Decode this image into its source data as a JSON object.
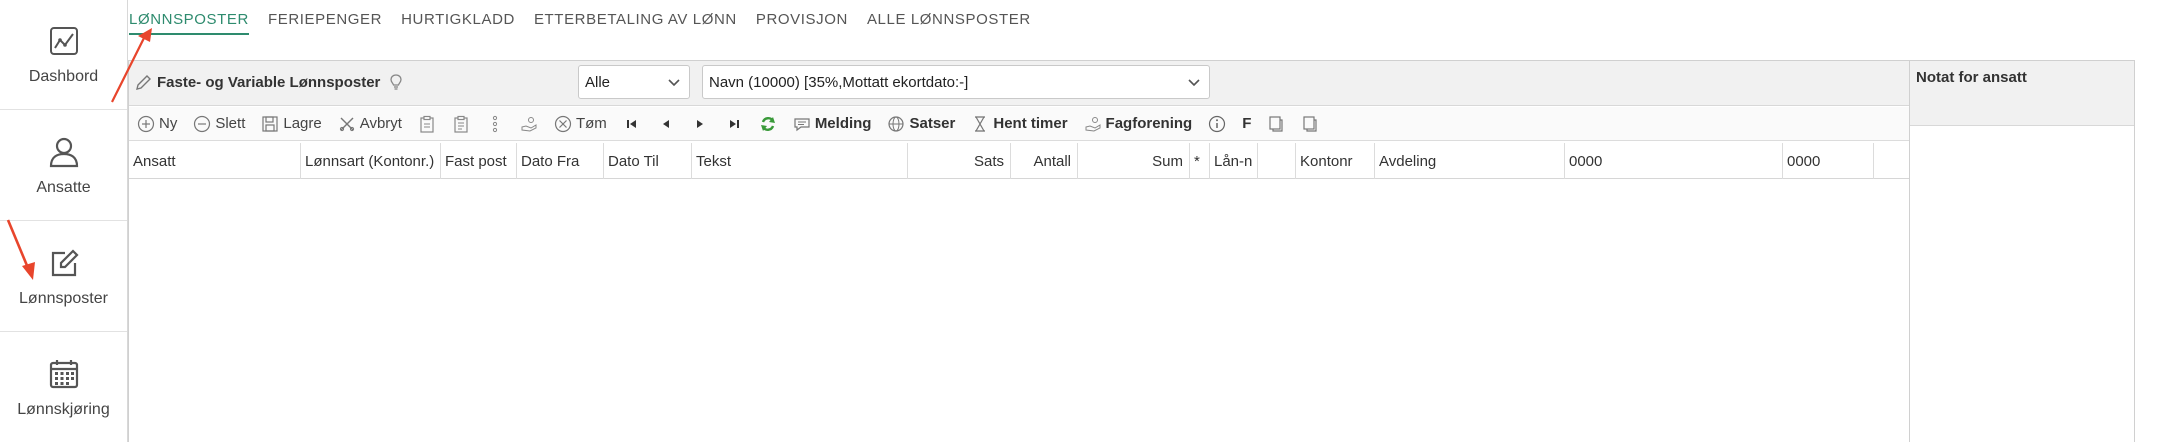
{
  "sidebar": {
    "items": [
      {
        "label": "Dashbord",
        "icon": "chart-icon"
      },
      {
        "label": "Ansatte",
        "icon": "person-icon"
      },
      {
        "label": "Lønnsposter",
        "icon": "edit-icon"
      },
      {
        "label": "Lønnskjøring",
        "icon": "calendar-icon"
      }
    ]
  },
  "tabs": [
    {
      "label": "LØNNSPOSTER",
      "active": true
    },
    {
      "label": "FERIEPENGER"
    },
    {
      "label": "HURTIGKLADD"
    },
    {
      "label": "ETTERBETALING AV LØNN"
    },
    {
      "label": "PROVISJON"
    },
    {
      "label": "ALLE LØNNSPOSTER"
    }
  ],
  "panel": {
    "title": "Faste- og Variable Lønnsposter",
    "filter_value": "Alle",
    "employee_value": "Navn (10000) [35%,Mottatt ekortdato:-]"
  },
  "toolbar": {
    "new": "Ny",
    "delete": "Slett",
    "save": "Lagre",
    "cancel": "Avbryt",
    "clear": "Tøm",
    "message": "Melding",
    "rates": "Satser",
    "get_hours": "Hent timer",
    "union": "Fagforening",
    "f": "F"
  },
  "table": {
    "columns": [
      "Ansatt",
      "Lønnsart (Kontonr.)",
      "Fast post",
      "Dato Fra",
      "Dato Til",
      "Tekst",
      "Sats",
      "Antall",
      "Sum",
      "*",
      "Lån-n",
      "",
      "Kontonr",
      "Avdeling",
      "0000",
      "0000",
      ""
    ]
  },
  "notes": {
    "title": "Notat for ansatt"
  },
  "colors": {
    "accent": "#2e8b6e",
    "arrow": "#e8452c"
  }
}
